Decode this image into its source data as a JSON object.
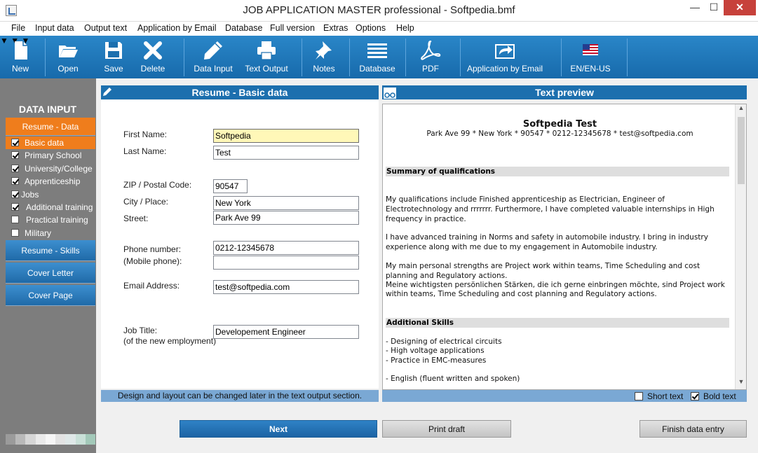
{
  "window": {
    "title": "JOB APPLICATION MASTER professional - Softpedia.bmf",
    "min": "—",
    "max": "☐",
    "close": "✕"
  },
  "menu": [
    "File",
    "Input data",
    "Output text",
    "Application by Email",
    "Database",
    "Full version",
    "Extras",
    "Options",
    "Help"
  ],
  "toolbar": {
    "new": "New",
    "open": "Open",
    "save": "Save",
    "delete": "Delete",
    "data_input": "Data Input",
    "text_output": "Text Output",
    "notes": "Notes",
    "database": "Database",
    "pdf": "PDF",
    "application_by_email": "Application by Email",
    "language": "EN/EN-US"
  },
  "sidebar": {
    "heading": "DATA INPUT",
    "sections": {
      "resume_data": "Resume - Data",
      "resume_skills": "Resume - Skills",
      "cover_letter": "Cover Letter",
      "cover_page": "Cover Page"
    },
    "items": [
      {
        "label": "Basic data",
        "checked": true
      },
      {
        "label": "Primary School",
        "checked": true
      },
      {
        "label": "University/College",
        "checked": true
      },
      {
        "label": "Apprenticeship",
        "checked": true
      },
      {
        "label": "Jobs",
        "checked": true
      },
      {
        "label": "Additional training",
        "checked": true
      },
      {
        "label": "Practical training",
        "checked": false
      },
      {
        "label": "Military",
        "checked": false
      }
    ]
  },
  "form": {
    "header": "Resume - Basic data",
    "labels": {
      "first_name": "First Name:",
      "last_name": "Last Name:",
      "zip": "ZIP / Postal Code:",
      "city": "City / Place:",
      "street": "Street:",
      "phone": "Phone number:",
      "mobile": "(Mobile phone):",
      "email": "Email Address:",
      "job_title": "Job Title:",
      "job_title_sub": "(of the new employment)"
    },
    "values": {
      "first_name": "Softpedia",
      "last_name": "Test",
      "zip": "90547",
      "city": "New York",
      "street": "Park Ave 99",
      "phone": "0212-12345678",
      "mobile": "",
      "email": "test@softpedia.com",
      "job_title": "Developement Engineer"
    },
    "hint": "Design and layout can be changed later in the text output section."
  },
  "preview": {
    "header": "Text preview",
    "name": "Softpedia Test",
    "address": "Park Ave 99 * New York * 90547 * 0212-12345678 * test@softpedia.com",
    "sec1_title": "Summary of qualifications",
    "p1_l1": "My qualifications include Finished apprenticeship as Electrician, Engineer of",
    "p1_l2": "Electrotechnology and rrrrrrr. Furthermore, I have completed valuable internships in High",
    "p1_l3": "frequency in practice.",
    "p2_l1": "I have advanced training in Norms and safety in automobile industry. I bring in industry",
    "p2_l2": "experience along with me due to my engagement in Automobile industry.",
    "p3_l1": "My main personal strengths are Project work within teams, Time Scheduling and cost",
    "p3_l2": "planning and Regulatory actions.",
    "p3_l3": "Meine wichtigsten persönlichen Stärken, die ich gerne einbringen möchte, sind Project work",
    "p3_l4": "within teams, Time Scheduling and cost planning and Regulatory actions.",
    "sec2_title": "Additional Skills",
    "skill1": "- Designing of electrical circuits",
    "skill2": "- High voltage applications",
    "skill3": "- Practice in EMC-measures",
    "skill4": "- English (fluent written and spoken)",
    "short_text": "Short text",
    "bold_text": "Bold text"
  },
  "buttons": {
    "next": "Next",
    "print_draft": "Print draft",
    "finish": "Finish data entry"
  },
  "colors": {
    "accent": "#1c6fae",
    "active": "#ef7d1c",
    "focus_input": "#fff8b8"
  }
}
